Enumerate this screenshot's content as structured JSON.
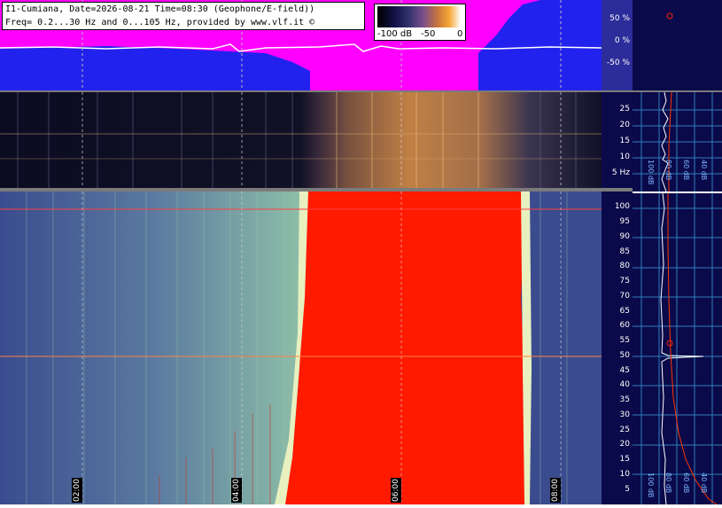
{
  "header": {
    "line1": "I1-Cumiana, Date=2026-08-21 Time=08:30 (Geophone/E-field))",
    "line2": "Freq= 0.2...30 Hz and 0...105 Hz, provided by www.vlf.it ©"
  },
  "colorbar": {
    "labels": [
      "-100 dB",
      "-50",
      "0"
    ]
  },
  "wave_axis": {
    "labels": [
      "50 %",
      "0 %",
      "-50 %"
    ]
  },
  "mid_axis": {
    "labels": [
      "25",
      "20",
      "15",
      "10",
      "5 Hz"
    ]
  },
  "bot_axis": {
    "labels": [
      "100",
      "95",
      "90",
      "85",
      "80",
      "75",
      "70",
      "65",
      "60",
      "55",
      "50",
      "45",
      "40",
      "35",
      "30",
      "25",
      "20",
      "15",
      "10",
      "5"
    ]
  },
  "time_markers": [
    "02:00",
    "04:00",
    "06:00",
    "08:00"
  ],
  "side_mid_db": [
    "100 dB",
    "80 dB",
    "60 dB",
    "40 dB",
    "20 dB"
  ],
  "side_bot_db": [
    "100 dB",
    "80 dB",
    "60 dB",
    "40 dB",
    "20 dB"
  ],
  "colors": {
    "magenta": "#ff00ff",
    "blue": "#2222ee",
    "navy": "#0a0a4a",
    "red_band": "#ff1a00",
    "grid_cyan": "#3a9ad6"
  }
}
